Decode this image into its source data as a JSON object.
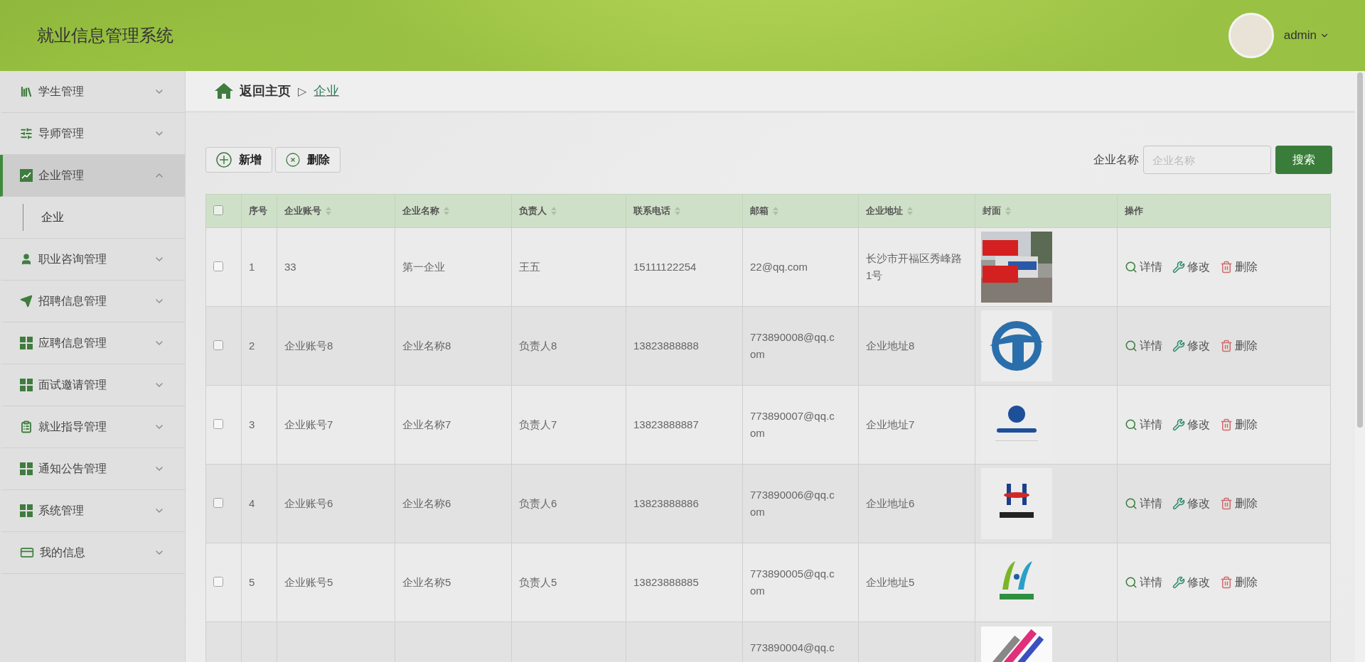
{
  "app": {
    "title": "就业信息管理系统"
  },
  "user": {
    "name": "admin"
  },
  "sidebar": {
    "items": [
      {
        "label": "学生管理",
        "selected": false,
        "expanded": false
      },
      {
        "label": "导师管理",
        "selected": false,
        "expanded": false
      },
      {
        "label": "企业管理",
        "selected": true,
        "expanded": true,
        "children": [
          {
            "label": "企业",
            "selected": false
          }
        ]
      },
      {
        "label": "职业咨询管理",
        "selected": false,
        "expanded": false
      },
      {
        "label": "招聘信息管理",
        "selected": false,
        "expanded": false
      },
      {
        "label": "应聘信息管理",
        "selected": false,
        "expanded": false
      },
      {
        "label": "面试邀请管理",
        "selected": false,
        "expanded": false
      },
      {
        "label": "就业指导管理",
        "selected": false,
        "expanded": false
      },
      {
        "label": "通知公告管理",
        "selected": false,
        "expanded": false
      },
      {
        "label": "系统管理",
        "selected": false,
        "expanded": false
      },
      {
        "label": "我的信息",
        "selected": false,
        "expanded": false
      }
    ]
  },
  "breadcrumb": {
    "home": "返回主页",
    "separator": "▷",
    "current": "企业"
  },
  "toolbar": {
    "buttons": [
      {
        "label": "新增",
        "kind": "add"
      },
      {
        "label": "删除",
        "kind": "delete"
      }
    ]
  },
  "search": {
    "label": "企业名称",
    "placeholder": "企业名称",
    "button": "搜索"
  },
  "table": {
    "header_checked": false,
    "columns": [
      {
        "label": "序号",
        "sortable": false
      },
      {
        "label": "企业账号",
        "sortable": true
      },
      {
        "label": "企业名称",
        "sortable": true
      },
      {
        "label": "负责人",
        "sortable": true
      },
      {
        "label": "联系电话",
        "sortable": true
      },
      {
        "label": "邮箱",
        "sortable": true
      },
      {
        "label": "企业地址",
        "sortable": true
      },
      {
        "label": "封面",
        "sortable": true
      },
      {
        "label": "操作",
        "sortable": false
      }
    ],
    "rows": [
      {
        "checked": false,
        "index": "1",
        "account": "33",
        "name": "第一企业",
        "contact": "王五",
        "phone": "15111122254",
        "email": "22@qq.com",
        "address": "长沙市开福区秀峰路1号",
        "actions": [
          "详情",
          "修改",
          "删除"
        ]
      },
      {
        "checked": false,
        "index": "2",
        "account": "企业账号8",
        "name": "企业名称8",
        "contact": "负责人8",
        "phone": "13823888888",
        "email": "773890008@qq.com",
        "address": "企业地址8",
        "actions": [
          "详情",
          "修改",
          "删除"
        ]
      },
      {
        "checked": false,
        "index": "3",
        "account": "企业账号7",
        "name": "企业名称7",
        "contact": "负责人7",
        "phone": "13823888887",
        "email": "773890007@qq.com",
        "address": "企业地址7",
        "actions": [
          "详情",
          "修改",
          "删除"
        ]
      },
      {
        "checked": false,
        "index": "4",
        "account": "企业账号6",
        "name": "企业名称6",
        "contact": "负责人6",
        "phone": "13823888886",
        "email": "773890006@qq.com",
        "address": "企业地址6",
        "actions": [
          "详情",
          "修改",
          "删除"
        ]
      },
      {
        "checked": false,
        "index": "5",
        "account": "企业账号5",
        "name": "企业名称5",
        "contact": "负责人5",
        "phone": "13823888885",
        "email": "773890005@qq.com",
        "address": "企业地址5",
        "actions": [
          "详情",
          "修改",
          "删除"
        ]
      },
      {
        "email": "773890004@qq.c"
      }
    ]
  }
}
